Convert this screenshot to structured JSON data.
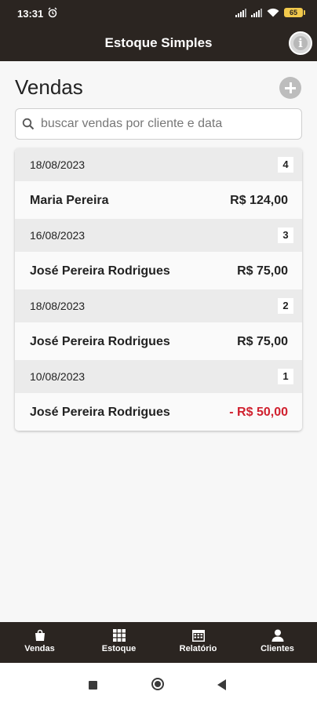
{
  "status": {
    "time": "13:31",
    "battery": "65"
  },
  "header": {
    "title": "Estoque Simples",
    "info_icon": "info-icon"
  },
  "page": {
    "title": "Vendas"
  },
  "search": {
    "placeholder": "buscar vendas por cliente e data"
  },
  "sales": [
    {
      "date": "18/08/2023",
      "count": "4",
      "client": "Maria Pereira",
      "amount": "R$ 124,00",
      "negative": false
    },
    {
      "date": "16/08/2023",
      "count": "3",
      "client": "José Pereira Rodrigues",
      "amount": "R$ 75,00",
      "negative": false
    },
    {
      "date": "18/08/2023",
      "count": "2",
      "client": "José Pereira Rodrigues",
      "amount": "R$ 75,00",
      "negative": false
    },
    {
      "date": "10/08/2023",
      "count": "1",
      "client": "José Pereira Rodrigues",
      "amount": "- R$ 50,00",
      "negative": true
    }
  ],
  "nav": {
    "items": [
      {
        "label": "Vendas",
        "icon": "shopping-bag-icon"
      },
      {
        "label": "Estoque",
        "icon": "grid-icon"
      },
      {
        "label": "Relatório",
        "icon": "calendar-icon"
      },
      {
        "label": "Clientes",
        "icon": "user-icon"
      }
    ]
  },
  "colors": {
    "bar": "#2b2521",
    "negative": "#d0202e"
  }
}
